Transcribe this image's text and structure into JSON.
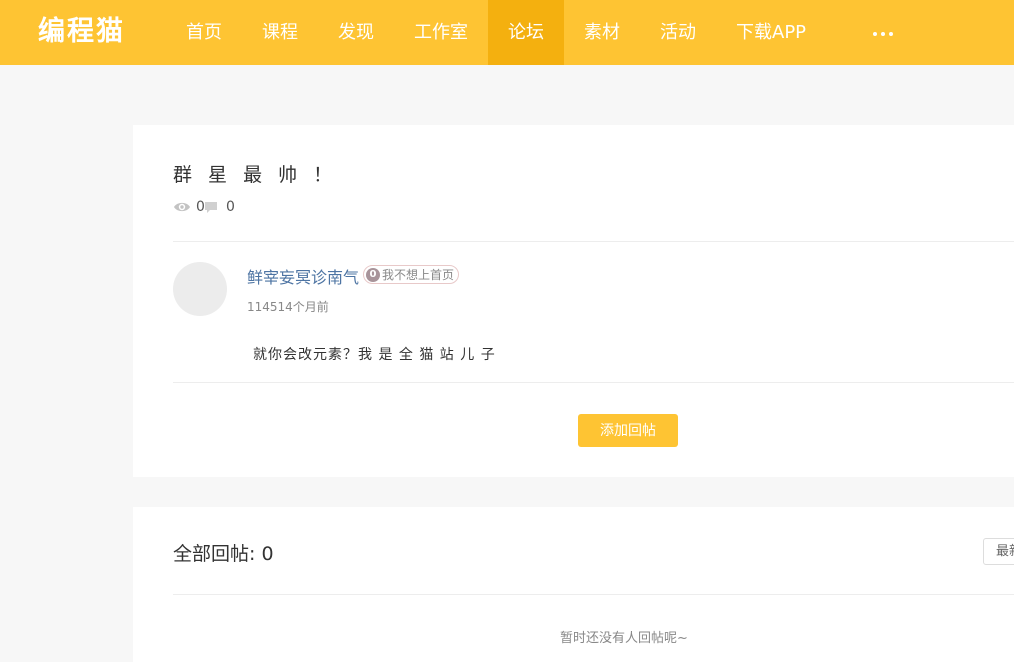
{
  "header": {
    "logo": "编程猫",
    "nav": [
      {
        "label": "首页",
        "active": false
      },
      {
        "label": "课程",
        "active": false
      },
      {
        "label": "发现",
        "active": false
      },
      {
        "label": "工作室",
        "active": false
      },
      {
        "label": "论坛",
        "active": true
      },
      {
        "label": "素材",
        "active": false
      },
      {
        "label": "活动",
        "active": false
      },
      {
        "label": "下载APP",
        "active": false
      }
    ],
    "more_icon": "more-dots-icon"
  },
  "post": {
    "title": "群 星 最 帅 ！",
    "views": "0",
    "comments": "0",
    "author": {
      "name": "鲜宰妄冥诊南气",
      "badge_level": "0",
      "badge_text": "我不想上首页",
      "time": "114514个月前"
    },
    "body": "就你会改元素？我 是 全 猫 站 儿 子",
    "reply_button": "添加回帖"
  },
  "replies": {
    "title": "全部回帖: 0",
    "sort_label": "最新",
    "empty_text": "暂时还没有人回帖呢~"
  },
  "colors": {
    "brand": "#fec433",
    "nav_active": "#f4b00f",
    "author_link": "#4d74a3"
  }
}
